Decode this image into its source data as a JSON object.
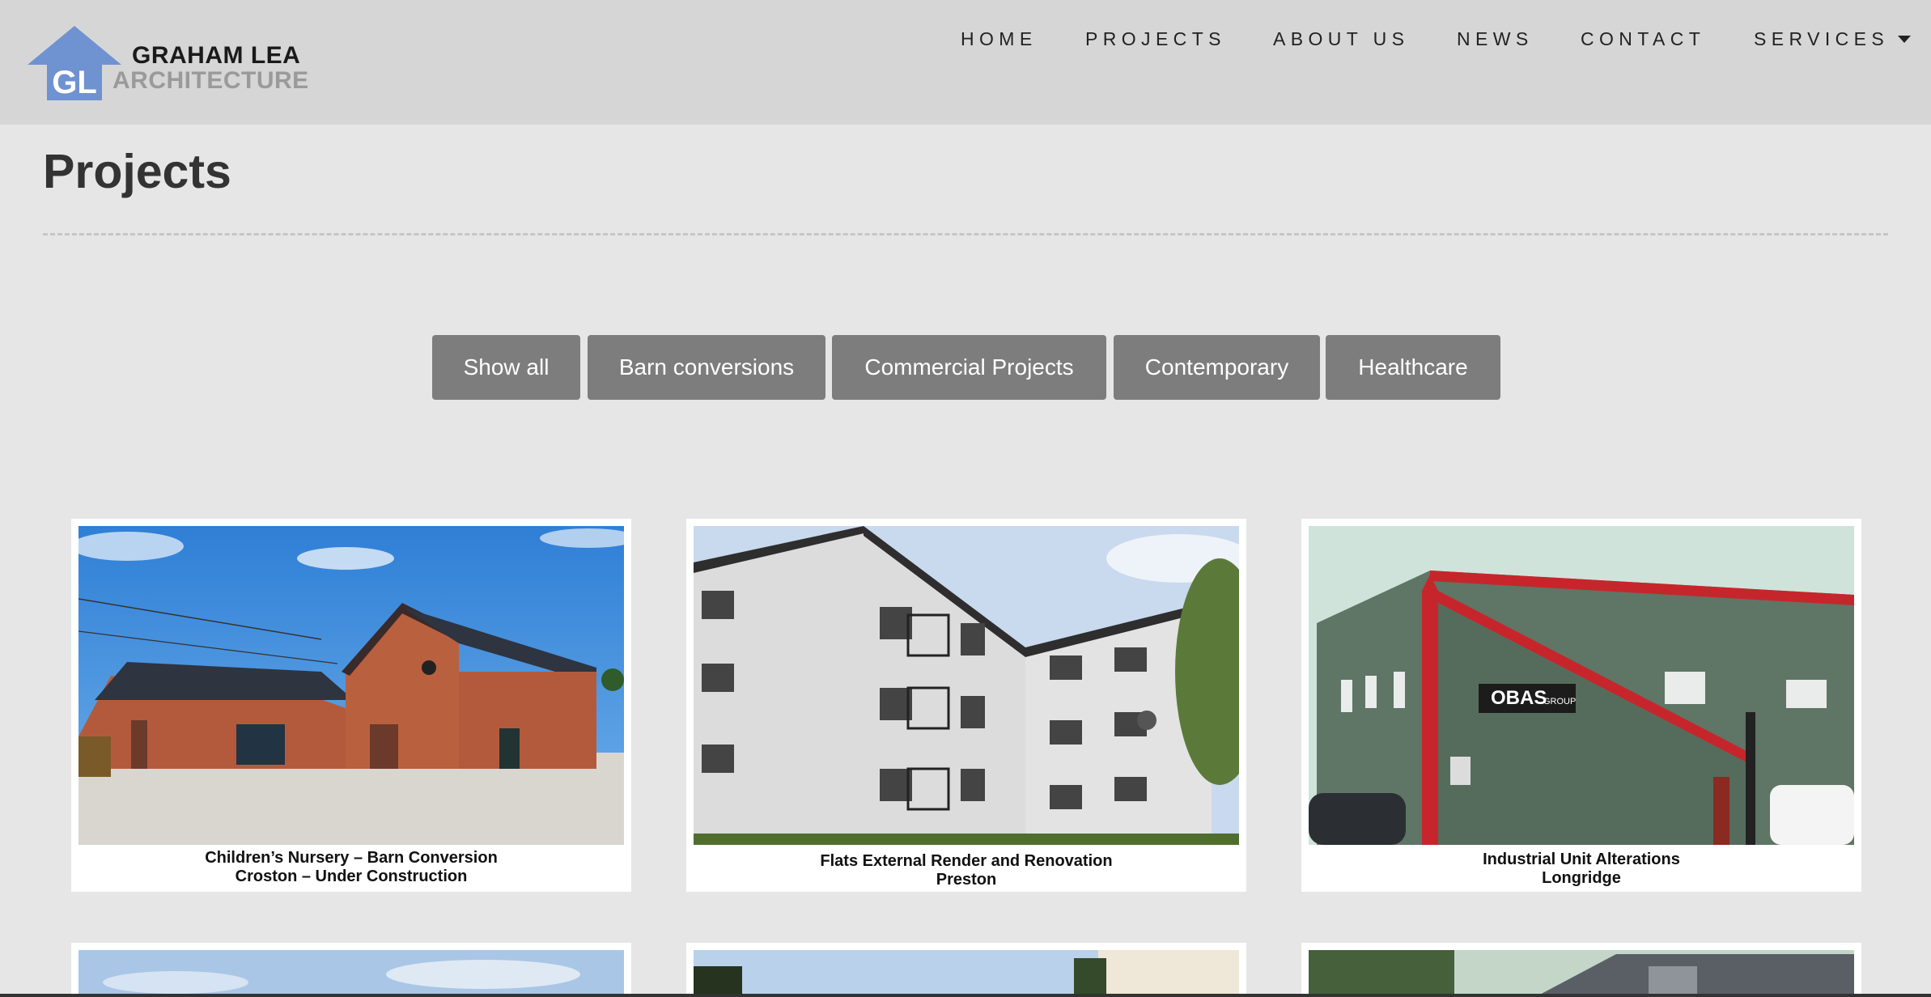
{
  "brand": {
    "monogram": "GL",
    "name_line1": "GRAHAM LEA",
    "name_line2": "ARCHITECTURE",
    "accent_color": "#6f92d0"
  },
  "nav": {
    "items": [
      "HOME",
      "PROJECTS",
      "ABOUT US",
      "NEWS",
      "CONTACT",
      "SERVICES"
    ],
    "dropdown_icon": "caret-down-icon"
  },
  "page": {
    "title": "Projects"
  },
  "filters": [
    "Show all",
    "Barn conversions",
    "Commercial Projects",
    "Contemporary",
    "Healthcare"
  ],
  "projects": [
    {
      "title": "Children’s Nursery – Barn Conversion",
      "subtitle": "Croston –  Under Construction"
    },
    {
      "title": "Flats External Render and Renovation",
      "subtitle": "Preston"
    },
    {
      "title": "Industrial Unit Alterations",
      "subtitle": "Longridge"
    },
    {
      "title": "",
      "subtitle": ""
    },
    {
      "title": "",
      "subtitle": ""
    },
    {
      "title": "",
      "subtitle": ""
    }
  ],
  "obas_sign": {
    "text": "OBAS",
    "suffix": "GROUP"
  },
  "colors": {
    "header_bg": "#d6d6d6",
    "page_bg": "#e6e6e6",
    "filter_bg": "#7d7d7d"
  }
}
